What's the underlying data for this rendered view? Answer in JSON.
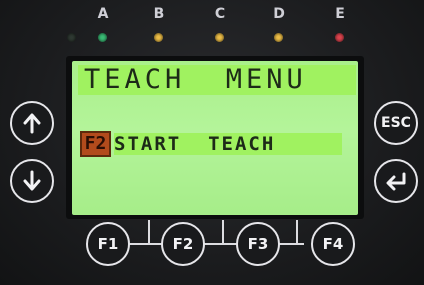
{
  "leds": [
    {
      "label": "",
      "color": "#2f3a33"
    },
    {
      "label": "A",
      "color": "#3bbf77"
    },
    {
      "label": "B",
      "color": "#f0c048"
    },
    {
      "label": "C",
      "color": "#f0c048"
    },
    {
      "label": "D",
      "color": "#f0c048"
    },
    {
      "label": "E",
      "color": "#e0454f"
    }
  ],
  "lcd": {
    "title": "TEACH  MENU",
    "item_key": "F2",
    "item_text": "START  TEACH",
    "background": "#b4f49a",
    "highlight": "#a0f260"
  },
  "buttons": {
    "up": {
      "icon": "arrow-up-icon"
    },
    "down": {
      "icon": "arrow-down-icon"
    },
    "esc": {
      "label": "ESC"
    },
    "enter": {
      "icon": "enter-arrow-icon"
    },
    "f1": {
      "label": "F1"
    },
    "f2": {
      "label": "F2"
    },
    "f3": {
      "label": "F3"
    },
    "f4": {
      "label": "F4"
    }
  }
}
